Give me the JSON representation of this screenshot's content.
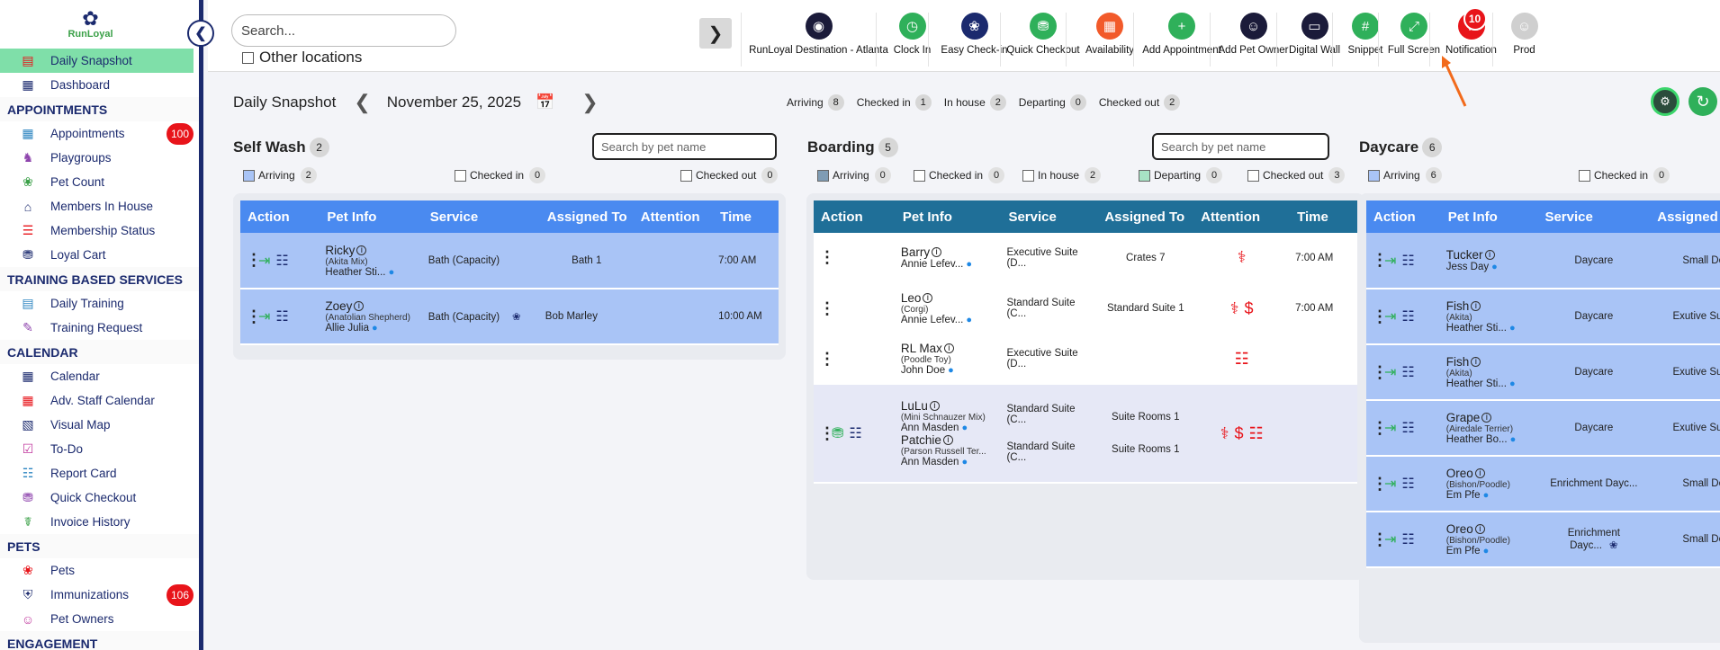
{
  "app": {
    "logo_text": "RunLoyal"
  },
  "search": {
    "placeholder": "Search...",
    "other_locations": "Other locations"
  },
  "sidebar": {
    "items": [
      {
        "label": "Daily Snapshot",
        "icon": "today-icon",
        "active": true
      },
      {
        "label": "Dashboard",
        "icon": "dashboard-icon"
      },
      {
        "section": "APPOINTMENTS"
      },
      {
        "label": "Appointments",
        "icon": "calendar-grid-icon",
        "badge": "100"
      },
      {
        "label": "Playgroups",
        "icon": "playgroups-icon"
      },
      {
        "label": "Pet Count",
        "icon": "pet-count-icon"
      },
      {
        "label": "Members In House",
        "icon": "members-house-icon"
      },
      {
        "label": "Membership Status",
        "icon": "membership-icon"
      },
      {
        "label": "Loyal Cart",
        "icon": "cart-icon"
      },
      {
        "section": "TRAINING BASED SERVICES"
      },
      {
        "label": "Daily Training",
        "icon": "today-icon"
      },
      {
        "label": "Training Request",
        "icon": "training-request-icon"
      },
      {
        "section": "CALENDAR"
      },
      {
        "label": "Calendar",
        "icon": "calendar-icon"
      },
      {
        "label": "Adv. Staff Calendar",
        "icon": "staff-calendar-icon"
      },
      {
        "label": "Visual Map",
        "icon": "map-icon"
      },
      {
        "label": "To-Do",
        "icon": "todo-icon"
      },
      {
        "label": "Report Card",
        "icon": "report-card-icon"
      },
      {
        "label": "Quick Checkout",
        "icon": "checkout-cart-icon"
      },
      {
        "label": "Invoice History",
        "icon": "invoice-icon"
      },
      {
        "section": "PETS"
      },
      {
        "label": "Pets",
        "icon": "paw-icon"
      },
      {
        "label": "Immunizations",
        "icon": "shield-icon",
        "badge": "106"
      },
      {
        "label": "Pet Owners",
        "icon": "person-icon"
      },
      {
        "section": "ENGAGEMENT"
      }
    ]
  },
  "toolbar": [
    {
      "label": "RunLoyal Destination - Atlanta",
      "icon": "location-pin-icon",
      "color": "#1b1b3a"
    },
    {
      "label": "Clock In",
      "icon": "clock-icon",
      "color": "#2fb05a"
    },
    {
      "label": "Easy Check-in",
      "icon": "paw-icon",
      "color": "#1b2a6e"
    },
    {
      "label": "Quick Checkout",
      "icon": "cart-icon",
      "color": "#2fb05a"
    },
    {
      "label": "Availability",
      "icon": "calendar-icon",
      "color": "#f25a2a"
    },
    {
      "label": "Add Appointment",
      "icon": "add-calendar-icon",
      "color": "#2fb05a"
    },
    {
      "label": "Add Pet Owner",
      "icon": "add-person-icon",
      "color": "#1b1b3a"
    },
    {
      "label": "Digital Wall",
      "icon": "monitor-icon",
      "color": "#1b1b3a"
    },
    {
      "label": "Snippet",
      "icon": "hash-icon",
      "color": "#2fb05a"
    },
    {
      "label": "Full Screen",
      "icon": "fullscreen-icon",
      "color": "#2fb05a"
    },
    {
      "label": "Notification",
      "icon": "bell-icon",
      "color": "#e8141a",
      "badge": "10"
    },
    {
      "label": "Prod",
      "icon": "avatar-icon",
      "color": "#cfcfcf"
    }
  ],
  "snapshot": {
    "title": "Daily Snapshot",
    "date": "November 25, 2025",
    "summary": [
      {
        "label": "Arriving",
        "count": "8"
      },
      {
        "label": "Checked in",
        "count": "1"
      },
      {
        "label": "In house",
        "count": "2"
      },
      {
        "label": "Departing",
        "count": "0"
      },
      {
        "label": "Checked out",
        "count": "2"
      }
    ]
  },
  "selfwash": {
    "title": "Self Wash",
    "count": "2",
    "search": "Search by pet name",
    "filters": [
      {
        "label": "Arriving",
        "count": "2"
      },
      {
        "label": "Checked in",
        "count": "0"
      },
      {
        "label": "Checked out",
        "count": "0"
      }
    ],
    "headers": [
      "Action",
      "Pet Info",
      "Service",
      "Assigned To",
      "Attention",
      "Time"
    ],
    "rows": [
      {
        "name": "Ricky",
        "breed": "(Akita Mix)",
        "owner": "Heather Sti...",
        "service": "Bath (Capacity)",
        "assigned": "Bath 1",
        "time": "7:00 AM"
      },
      {
        "name": "Zoey",
        "breed": "(Anatolian Shepherd)",
        "owner": "Allie Julia",
        "service": "Bath (Capacity)",
        "assigned": "Bob Marley",
        "time": "10:00 AM"
      }
    ]
  },
  "boarding": {
    "title": "Boarding",
    "count": "5",
    "search": "Search by pet name",
    "filters": [
      {
        "label": "Arriving",
        "count": "0"
      },
      {
        "label": "Checked in",
        "count": "0"
      },
      {
        "label": "In house",
        "count": "2"
      },
      {
        "label": "Departing",
        "count": "0"
      },
      {
        "label": "Checked out",
        "count": "3"
      }
    ],
    "headers": [
      "Action",
      "Pet Info",
      "Service",
      "Assigned To",
      "Attention",
      "Time"
    ],
    "rows": [
      {
        "name": "Barry",
        "breed": "",
        "owner": "Annie Lefev...",
        "service": "Executive Suite (D...",
        "assigned": "Crates 7",
        "time": "7:00 AM"
      },
      {
        "name": "Leo",
        "breed": "(Corgi)",
        "owner": "Annie Lefev...",
        "service": "Standard Suite (C...",
        "assigned": "Standard Suite 1",
        "time": "7:00 AM"
      },
      {
        "name": "RL Max",
        "breed": "(Poodle Toy)",
        "owner": "John Doe",
        "service": "Executive Suite (D...",
        "assigned": "",
        "time": ""
      },
      {
        "name": "LuLu",
        "breed": "(Mini Schnauzer Mix)",
        "owner": "Ann Masden",
        "service": "Standard Suite (C...",
        "assigned": "Suite Rooms 1",
        "name2": "Patchie",
        "breed2": "(Parson Russell Ter...",
        "owner2": "Ann Masden",
        "service2": "Standard Suite (C...",
        "assigned2": "Suite Rooms 1"
      }
    ]
  },
  "daycare": {
    "title": "Daycare",
    "count": "6",
    "filters": [
      {
        "label": "Arriving",
        "count": "6"
      },
      {
        "label": "Checked in",
        "count": "0"
      }
    ],
    "headers": [
      "Action",
      "Pet Info",
      "Service",
      "Assigned"
    ],
    "rows": [
      {
        "name": "Tucker",
        "breed": "",
        "owner": "Jess Day",
        "service": "Daycare",
        "assigned": "Small Do"
      },
      {
        "name": "Fish",
        "breed": "(Akita)",
        "owner": "Heather Sti...",
        "service": "Daycare",
        "assigned": "Exutive Sui"
      },
      {
        "name": "Fish",
        "breed": "(Akita)",
        "owner": "Heather Sti...",
        "service": "Daycare",
        "assigned": "Exutive Sui"
      },
      {
        "name": "Grape",
        "breed": "(Airedale Terrier)",
        "owner": "Heather Bo...",
        "service": "Daycare",
        "assigned": "Exutive Sui"
      },
      {
        "name": "Oreo",
        "breed": "(Bishon/Poodle)",
        "owner": "Em Pfe",
        "service": "Enrichment Dayc...",
        "assigned": "Small Do"
      },
      {
        "name": "Oreo",
        "breed": "(Bishon/Poodle)",
        "owner": "Em Pfe",
        "service": "Enrichment Dayc...",
        "assigned": "Small Do"
      }
    ]
  }
}
